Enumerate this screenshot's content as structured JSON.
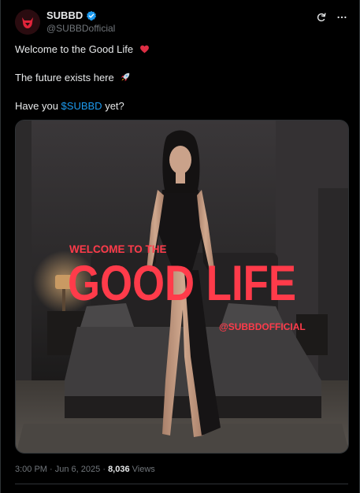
{
  "header": {
    "display_name": "SUBBD",
    "handle": "@SUBBDofficial",
    "icons": {
      "avatar": "devil-logo-icon",
      "verified": "verified-badge-icon",
      "refresh": "grok-refresh-icon",
      "more": "more-dots-icon"
    }
  },
  "post": {
    "line1": "Welcome to the Good Life",
    "line1_emoji": "heart-icon",
    "line2": "The future exists here",
    "line2_emoji": "rocket-icon",
    "line3_before": "Have you",
    "line3_cashtag": "$SUBBD",
    "line3_after": "yet?"
  },
  "image": {
    "headline_small": "WELCOME TO THE",
    "headline_large": "GOOD LIFE",
    "watermark": "@SUBBDOFFICIAL",
    "accent_color": "#ff3b4a"
  },
  "meta": {
    "time": "3:00 PM",
    "separator": "·",
    "date": "Jun 6, 2025",
    "views_count": "8,036",
    "views_label": "Views"
  },
  "colors": {
    "background": "#000000",
    "text": "#e7e9ea",
    "muted": "#71767b",
    "link": "#1d9bf0",
    "border": "#2f3336",
    "verified": "#1d9bf0"
  }
}
